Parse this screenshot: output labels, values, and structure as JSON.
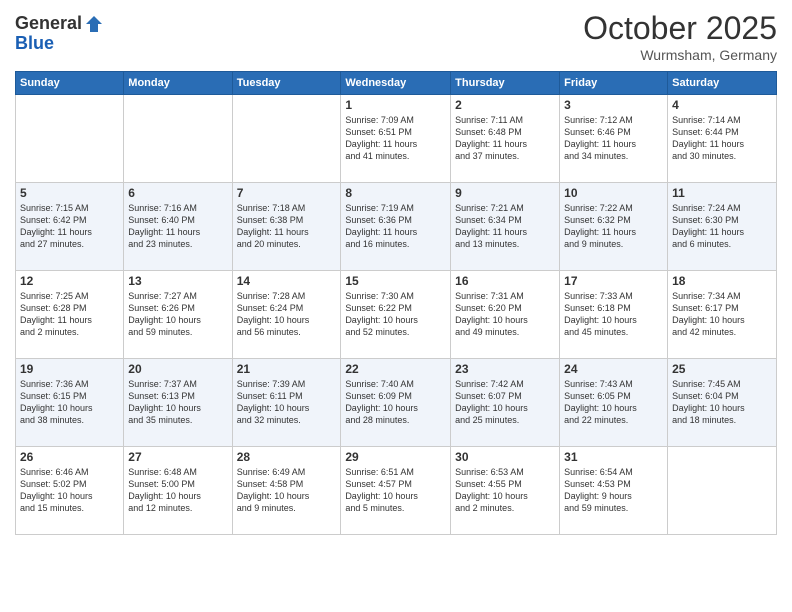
{
  "header": {
    "logo_general": "General",
    "logo_blue": "Blue",
    "month": "October 2025",
    "location": "Wurmsham, Germany"
  },
  "days_of_week": [
    "Sunday",
    "Monday",
    "Tuesday",
    "Wednesday",
    "Thursday",
    "Friday",
    "Saturday"
  ],
  "weeks": [
    [
      {
        "day": "",
        "info": ""
      },
      {
        "day": "",
        "info": ""
      },
      {
        "day": "",
        "info": ""
      },
      {
        "day": "1",
        "info": "Sunrise: 7:09 AM\nSunset: 6:51 PM\nDaylight: 11 hours\nand 41 minutes."
      },
      {
        "day": "2",
        "info": "Sunrise: 7:11 AM\nSunset: 6:48 PM\nDaylight: 11 hours\nand 37 minutes."
      },
      {
        "day": "3",
        "info": "Sunrise: 7:12 AM\nSunset: 6:46 PM\nDaylight: 11 hours\nand 34 minutes."
      },
      {
        "day": "4",
        "info": "Sunrise: 7:14 AM\nSunset: 6:44 PM\nDaylight: 11 hours\nand 30 minutes."
      }
    ],
    [
      {
        "day": "5",
        "info": "Sunrise: 7:15 AM\nSunset: 6:42 PM\nDaylight: 11 hours\nand 27 minutes."
      },
      {
        "day": "6",
        "info": "Sunrise: 7:16 AM\nSunset: 6:40 PM\nDaylight: 11 hours\nand 23 minutes."
      },
      {
        "day": "7",
        "info": "Sunrise: 7:18 AM\nSunset: 6:38 PM\nDaylight: 11 hours\nand 20 minutes."
      },
      {
        "day": "8",
        "info": "Sunrise: 7:19 AM\nSunset: 6:36 PM\nDaylight: 11 hours\nand 16 minutes."
      },
      {
        "day": "9",
        "info": "Sunrise: 7:21 AM\nSunset: 6:34 PM\nDaylight: 11 hours\nand 13 minutes."
      },
      {
        "day": "10",
        "info": "Sunrise: 7:22 AM\nSunset: 6:32 PM\nDaylight: 11 hours\nand 9 minutes."
      },
      {
        "day": "11",
        "info": "Sunrise: 7:24 AM\nSunset: 6:30 PM\nDaylight: 11 hours\nand 6 minutes."
      }
    ],
    [
      {
        "day": "12",
        "info": "Sunrise: 7:25 AM\nSunset: 6:28 PM\nDaylight: 11 hours\nand 2 minutes."
      },
      {
        "day": "13",
        "info": "Sunrise: 7:27 AM\nSunset: 6:26 PM\nDaylight: 10 hours\nand 59 minutes."
      },
      {
        "day": "14",
        "info": "Sunrise: 7:28 AM\nSunset: 6:24 PM\nDaylight: 10 hours\nand 56 minutes."
      },
      {
        "day": "15",
        "info": "Sunrise: 7:30 AM\nSunset: 6:22 PM\nDaylight: 10 hours\nand 52 minutes."
      },
      {
        "day": "16",
        "info": "Sunrise: 7:31 AM\nSunset: 6:20 PM\nDaylight: 10 hours\nand 49 minutes."
      },
      {
        "day": "17",
        "info": "Sunrise: 7:33 AM\nSunset: 6:18 PM\nDaylight: 10 hours\nand 45 minutes."
      },
      {
        "day": "18",
        "info": "Sunrise: 7:34 AM\nSunset: 6:17 PM\nDaylight: 10 hours\nand 42 minutes."
      }
    ],
    [
      {
        "day": "19",
        "info": "Sunrise: 7:36 AM\nSunset: 6:15 PM\nDaylight: 10 hours\nand 38 minutes."
      },
      {
        "day": "20",
        "info": "Sunrise: 7:37 AM\nSunset: 6:13 PM\nDaylight: 10 hours\nand 35 minutes."
      },
      {
        "day": "21",
        "info": "Sunrise: 7:39 AM\nSunset: 6:11 PM\nDaylight: 10 hours\nand 32 minutes."
      },
      {
        "day": "22",
        "info": "Sunrise: 7:40 AM\nSunset: 6:09 PM\nDaylight: 10 hours\nand 28 minutes."
      },
      {
        "day": "23",
        "info": "Sunrise: 7:42 AM\nSunset: 6:07 PM\nDaylight: 10 hours\nand 25 minutes."
      },
      {
        "day": "24",
        "info": "Sunrise: 7:43 AM\nSunset: 6:05 PM\nDaylight: 10 hours\nand 22 minutes."
      },
      {
        "day": "25",
        "info": "Sunrise: 7:45 AM\nSunset: 6:04 PM\nDaylight: 10 hours\nand 18 minutes."
      }
    ],
    [
      {
        "day": "26",
        "info": "Sunrise: 6:46 AM\nSunset: 5:02 PM\nDaylight: 10 hours\nand 15 minutes."
      },
      {
        "day": "27",
        "info": "Sunrise: 6:48 AM\nSunset: 5:00 PM\nDaylight: 10 hours\nand 12 minutes."
      },
      {
        "day": "28",
        "info": "Sunrise: 6:49 AM\nSunset: 4:58 PM\nDaylight: 10 hours\nand 9 minutes."
      },
      {
        "day": "29",
        "info": "Sunrise: 6:51 AM\nSunset: 4:57 PM\nDaylight: 10 hours\nand 5 minutes."
      },
      {
        "day": "30",
        "info": "Sunrise: 6:53 AM\nSunset: 4:55 PM\nDaylight: 10 hours\nand 2 minutes."
      },
      {
        "day": "31",
        "info": "Sunrise: 6:54 AM\nSunset: 4:53 PM\nDaylight: 9 hours\nand 59 minutes."
      },
      {
        "day": "",
        "info": ""
      }
    ]
  ]
}
